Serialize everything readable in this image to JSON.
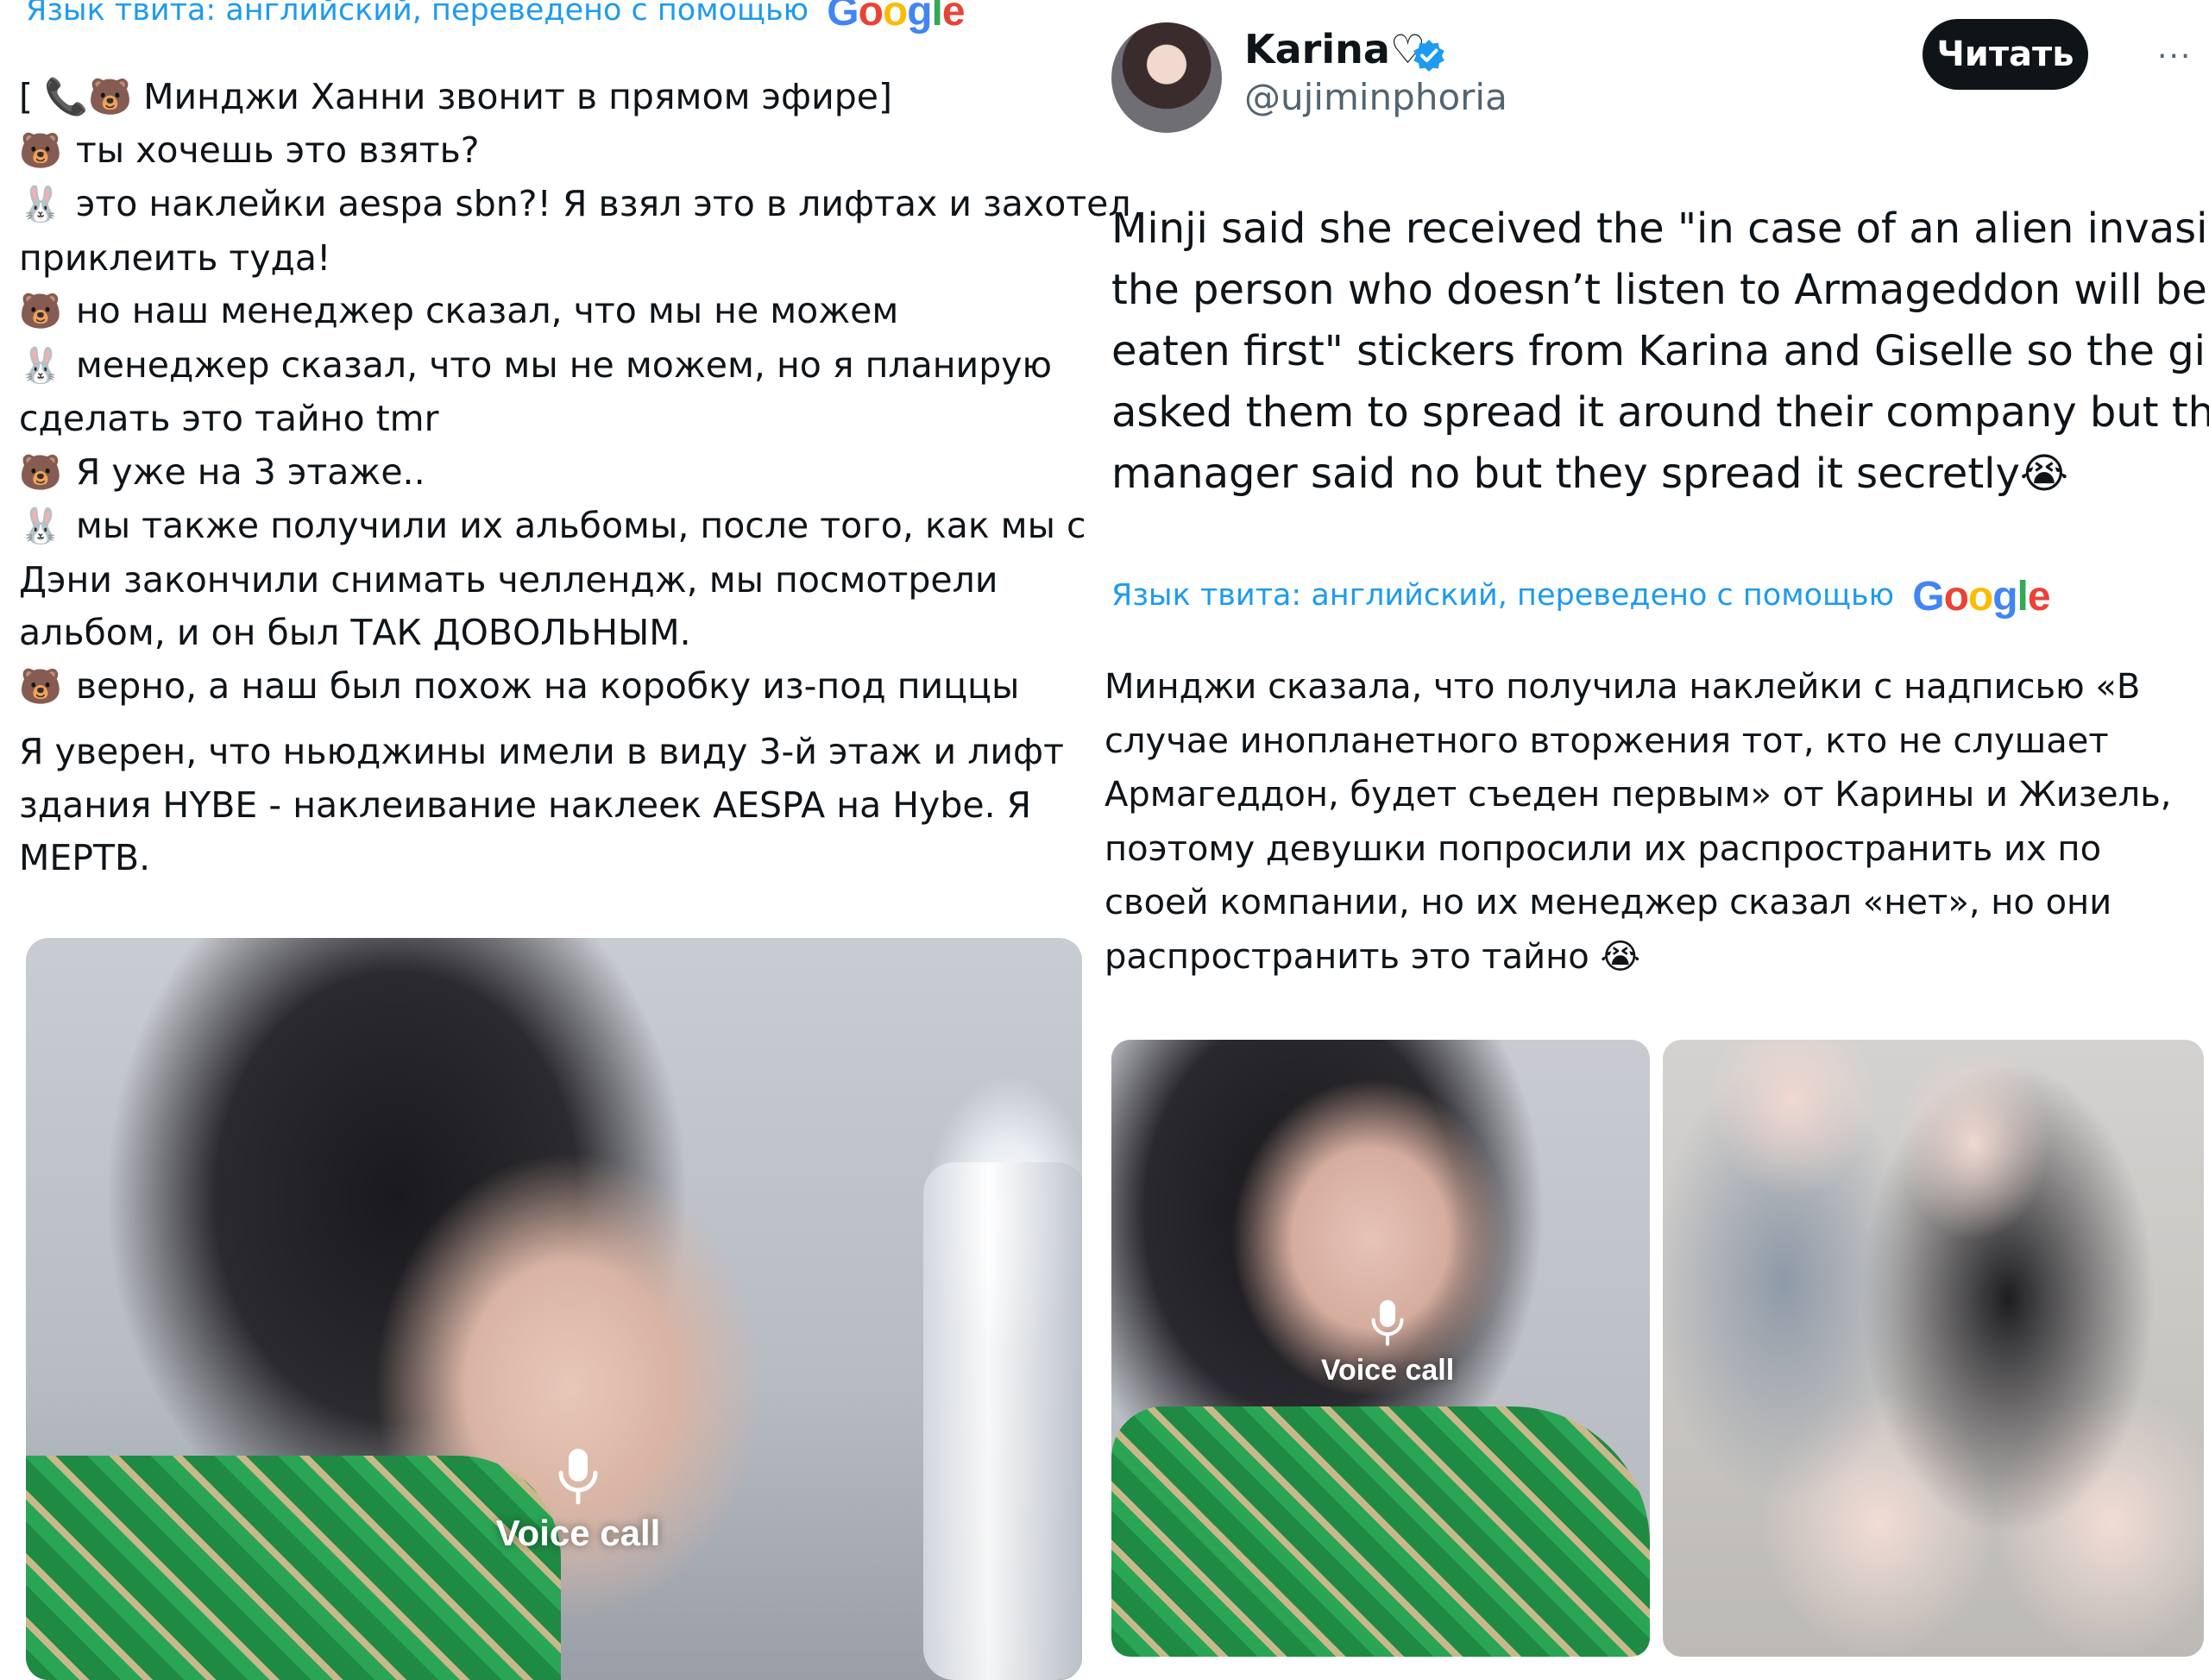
{
  "left_tweet": {
    "translation_note": "Язык твита: английский, переведено с помощью",
    "translation_provider": "Google",
    "lines": [
      {
        "emoji": "",
        "text": "[ 📞🐻 Минджи Ханни звонит в прямом эфире]"
      },
      {
        "emoji": "🐻",
        "text": "ты хочешь это взять?"
      },
      {
        "emoji": "🐰",
        "text": "это наклейки aespa sbn?! Я взял это в лифтах и захотел"
      },
      {
        "emoji": "",
        "text": "приклеить туда!"
      },
      {
        "emoji": "🐻",
        "text": "но наш менеджер сказал, что мы не можем"
      },
      {
        "emoji": "🐰",
        "text": "менеджер сказал, что мы не можем, но я планирую"
      },
      {
        "emoji": "",
        "text": "сделать это тайно tmr"
      },
      {
        "emoji": "🐻",
        "text": "Я уже на 3 этаже.."
      },
      {
        "emoji": "🐰",
        "text": "мы также получили их альбомы, после того, как мы с"
      },
      {
        "emoji": "",
        "text": "Дэни закончили снимать челлендж, мы посмотрели"
      },
      {
        "emoji": "",
        "text": "альбом, и он был ТАК ДОВОЛЬНЫМ."
      },
      {
        "emoji": "🐻",
        "text": "верно, а наш был похож на коробку из-под пиццы"
      }
    ],
    "comment_lines": [
      "Я уверен, что ньюджины имели в виду 3-й этаж и лифт",
      "здания HYBE - наклеивание наклеек AESPA на Hybe. Я",
      "МЕРТВ."
    ],
    "media_label": "Voice call"
  },
  "right_tweet": {
    "author_name": "Karina♡",
    "author_handle": "@ujiminphoria",
    "follow_label": "Читать",
    "more_label": "···",
    "text_lines": [
      "Minji said she received the \"in case of an alien invasion,",
      "the person who doesn’t listen to Armageddon will be",
      "eaten first\" stickers from Karina and Giselle so the girls",
      "asked them to spread it around their company but their",
      "manager said no but they spread it secretly😭"
    ],
    "translation_note": "Язык твита: английский, переведено с помощью",
    "translation_provider": "Google",
    "translated_lines": [
      "Минджи сказала, что получила наклейки с надписью «В",
      "случае инопланетного вторжения тот, кто не слушает",
      "Армагеддон, будет съеден первым» от Карины и Жизель,",
      "поэтому девушки попросили их распространить их по",
      "своей компании, но их менеджер сказал «нет», но они",
      "распространить это тайно 😭"
    ],
    "media_label": "Voice call"
  },
  "colors": {
    "link_blue": "#1d9bf0",
    "text": "#0f1419",
    "secondary": "#536471",
    "verified": "#1d9bf0",
    "google": [
      "#4285f4",
      "#ea4335",
      "#fbbc05",
      "#34a853"
    ]
  }
}
